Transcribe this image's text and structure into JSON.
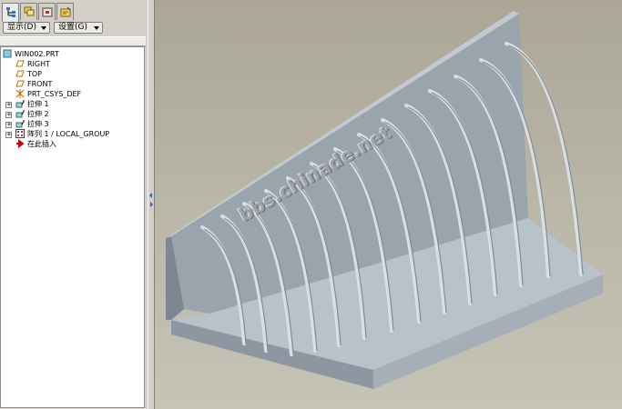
{
  "panel": {
    "tabs": [
      {
        "icon": "model-tree-icon",
        "active": true
      },
      {
        "icon": "layers-icon",
        "active": false
      },
      {
        "icon": "folder-browser-icon",
        "active": false
      },
      {
        "icon": "favorites-icon",
        "active": false
      }
    ],
    "show_button": "显示(D)",
    "settings_button": "设置(G)"
  },
  "tree": {
    "items": [
      {
        "label": "WIN002.PRT",
        "icon": "part-icon"
      },
      {
        "label": "RIGHT",
        "icon": "datum-plane-icon"
      },
      {
        "label": "TOP",
        "icon": "datum-plane-icon"
      },
      {
        "label": "FRONT",
        "icon": "datum-plane-icon"
      },
      {
        "label": "PRT_CSYS_DEF",
        "icon": "coordinate-system-icon"
      },
      {
        "label": "拉伸 1",
        "icon": "extrude-icon"
      },
      {
        "label": "拉伸 2",
        "icon": "extrude-icon"
      },
      {
        "label": "拉伸 3",
        "icon": "extrude-icon"
      },
      {
        "label": "阵列 1 / LOCAL_GROUP",
        "icon": "pattern-icon"
      },
      {
        "label": "在此插入",
        "icon": "insert-here-arrow-icon"
      }
    ]
  },
  "viewport": {
    "watermark": "bbs.chinade.net",
    "colors": {
      "background": "#b4b0a2",
      "model": "#a9b3bc",
      "model_dark": "#7d8791"
    }
  }
}
